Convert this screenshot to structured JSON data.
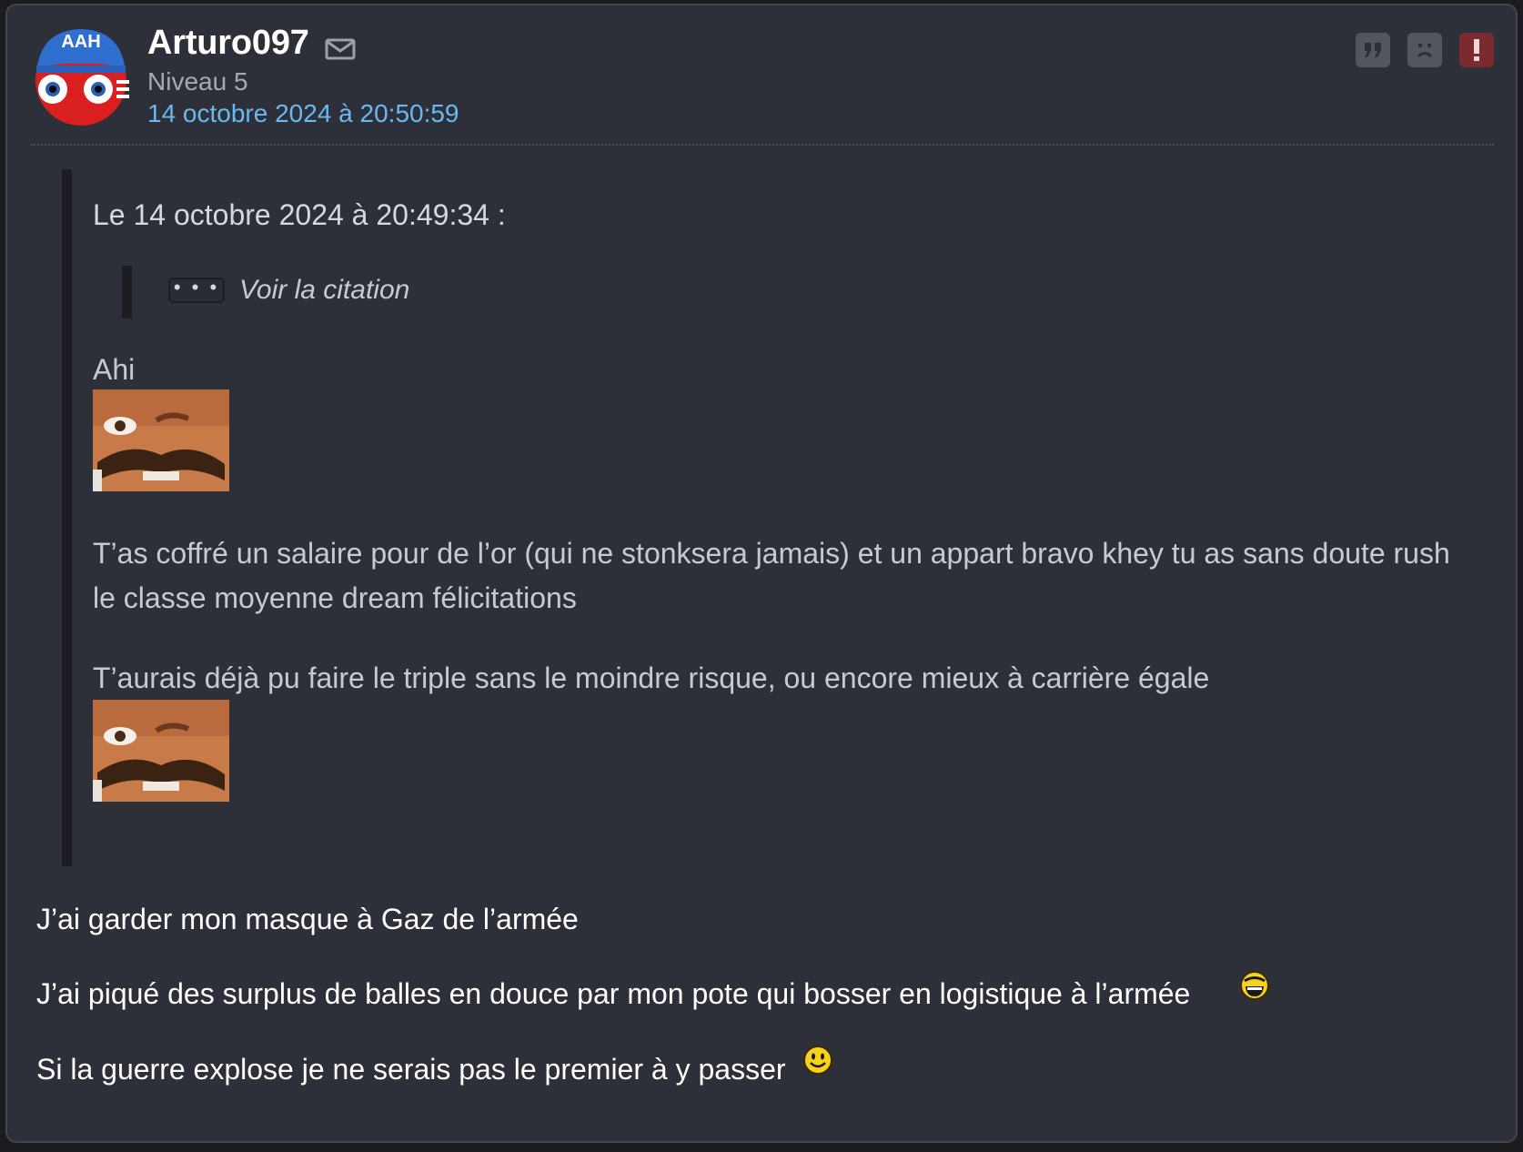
{
  "author": {
    "name": "Arturo097",
    "level": "Niveau 5",
    "date": "14 octobre 2024 à 20:50:59",
    "avatar_text": "AAH"
  },
  "actions": {
    "quote_icon": "quote-icon",
    "sad_icon": "sad-face-icon",
    "alert_icon": "exclamation-icon",
    "mail_icon": "envelope-icon"
  },
  "quote": {
    "header": "Le 14 octobre 2024 à 20:49:34 :",
    "nested": {
      "ellipsis": "• • •",
      "label": "Voir la citation"
    },
    "line1": "Ahi",
    "paragraph1": "T’as coffré un salaire pour de l’or (qui ne stonksera jamais) et un appart bravo khey tu as sans doute rush le classe moyenne dream félicitations",
    "paragraph2": "T’aurais déjà pu faire le triple sans le moindre risque, ou encore mieux à carrière égale"
  },
  "message": {
    "line1": "J’ai garder mon masque à Gaz de l’armée",
    "line2": "J’ai piqué des surplus de balles en douce par mon pote qui bosser en logistique à l’armée",
    "line3": "Si la guerre explose je ne serais pas le premier à y passer"
  },
  "colors": {
    "background": "#2e3039",
    "date_link": "#6ab8f0",
    "alert": "#7b2a2f"
  }
}
